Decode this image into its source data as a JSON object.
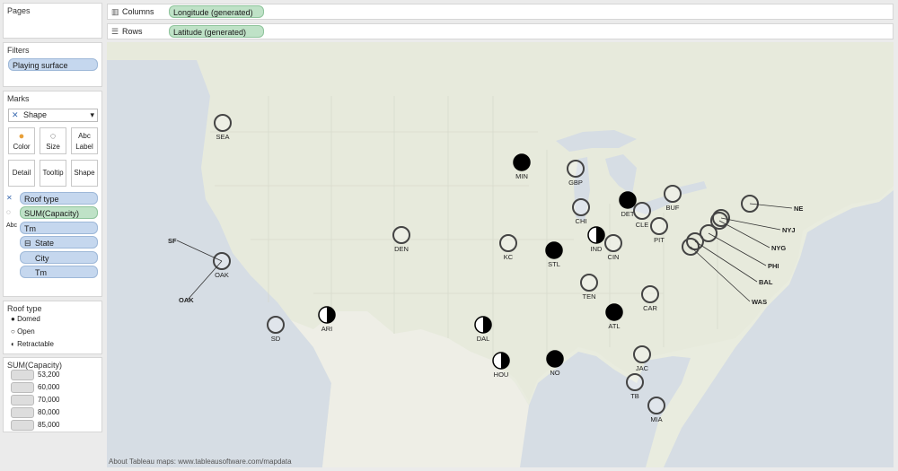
{
  "pages": {
    "title": "Pages"
  },
  "filters": {
    "title": "Filters",
    "items": [
      "Playing surface"
    ]
  },
  "marks": {
    "title": "Marks",
    "type": "Shape",
    "buttons": [
      "Color",
      "Size",
      "Label",
      "Detail",
      "Tooltip",
      "Shape"
    ],
    "fields": [
      "Roof type",
      "SUM(Capacity)",
      "Tm",
      "State",
      "City",
      "Tm"
    ]
  },
  "legend_roof": {
    "title": "Roof type",
    "items": [
      "Domed",
      "Open",
      "Retractable"
    ]
  },
  "legend_size": {
    "title": "SUM(Capacity)",
    "items": [
      "53,200",
      "60,000",
      "70,000",
      "80,000",
      "85,000"
    ]
  },
  "shelves": {
    "columns_label": "Columns",
    "columns_pill": "Longitude (generated)",
    "rows_label": "Rows",
    "rows_pill": "Latitude (generated)"
  },
  "map": {
    "footer": "About Tableau maps: www.tableausoftware.com/mapdata",
    "teams": [
      {
        "code": "SEA",
        "roof": "open"
      },
      {
        "code": "MIN",
        "roof": "domed"
      },
      {
        "code": "GBP",
        "roof": "open"
      },
      {
        "code": "DET",
        "roof": "domed"
      },
      {
        "code": "BUF",
        "roof": "open"
      },
      {
        "code": "CHI",
        "roof": "open"
      },
      {
        "code": "CLE",
        "roof": "open"
      },
      {
        "code": "PIT",
        "roof": "open"
      },
      {
        "code": "DEN",
        "roof": "open"
      },
      {
        "code": "KC",
        "roof": "open"
      },
      {
        "code": "STL",
        "roof": "domed"
      },
      {
        "code": "IND",
        "roof": "retractable"
      },
      {
        "code": "CIN",
        "roof": "open"
      },
      {
        "code": "OAK",
        "roof": "open"
      },
      {
        "code": "TEN",
        "roof": "open"
      },
      {
        "code": "CAR",
        "roof": "open"
      },
      {
        "code": "ATL",
        "roof": "domed"
      },
      {
        "code": "SD",
        "roof": "open"
      },
      {
        "code": "ARI",
        "roof": "retractable"
      },
      {
        "code": "DAL",
        "roof": "retractable"
      },
      {
        "code": "HOU",
        "roof": "retractable"
      },
      {
        "code": "NO",
        "roof": "domed"
      },
      {
        "code": "JAC",
        "roof": "open"
      },
      {
        "code": "TB",
        "roof": "open"
      },
      {
        "code": "MIA",
        "roof": "open"
      }
    ],
    "callouts": [
      "SF",
      "OAK",
      "NE",
      "NYJ",
      "NYG",
      "PHI",
      "BAL",
      "WAS"
    ]
  }
}
